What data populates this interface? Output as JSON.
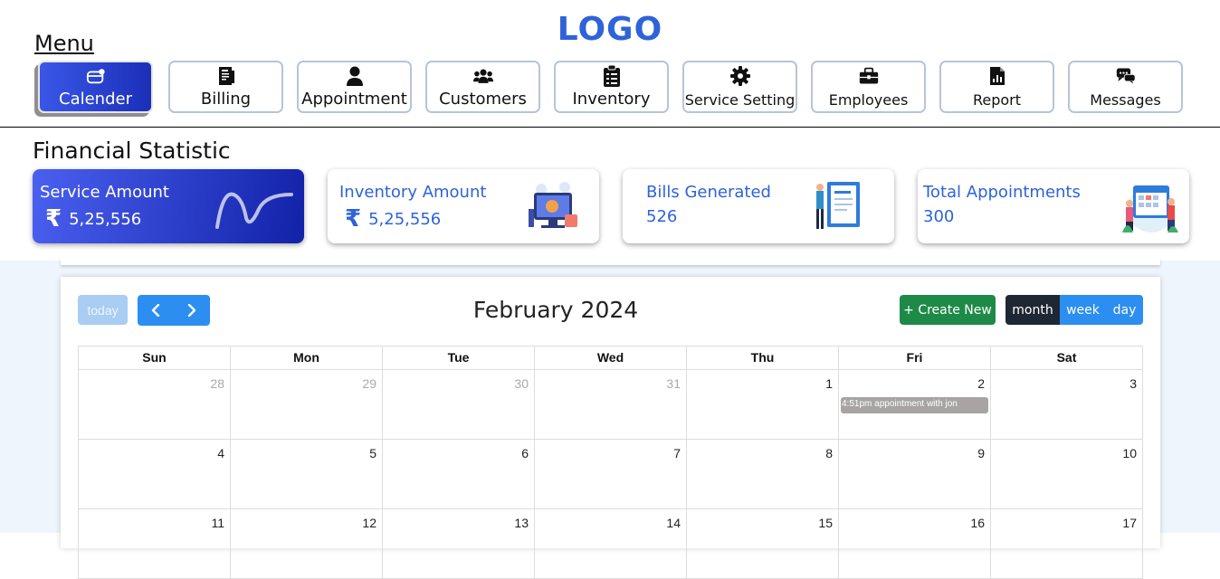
{
  "header": {
    "logo": "LOGO",
    "menu_title": "Menu"
  },
  "nav": [
    {
      "label": "Calender",
      "icon": "calendar-icon",
      "active": true
    },
    {
      "label": "Billing",
      "icon": "bill-icon"
    },
    {
      "label": "Appointment",
      "icon": "user-icon"
    },
    {
      "label": "Customers",
      "icon": "users-icon"
    },
    {
      "label": "Inventory",
      "icon": "clipboard-icon"
    },
    {
      "label": "Service Setting",
      "icon": "gear-icon"
    },
    {
      "label": "Employees",
      "icon": "briefcase-icon"
    },
    {
      "label": "Report",
      "icon": "report-icon"
    },
    {
      "label": "Messages",
      "icon": "messages-icon"
    }
  ],
  "financial": {
    "title": "Financial Statistic",
    "cards": [
      {
        "title": "Service Amount",
        "currency": "₹",
        "value": "5,25,556"
      },
      {
        "title": "Inventory Amount",
        "currency": "₹",
        "value": "5,25,556"
      },
      {
        "title": "Bills Generated",
        "value": "526"
      },
      {
        "title": "Total Appointments",
        "value": "300"
      }
    ]
  },
  "calendar": {
    "today_label": "today",
    "prev_icon": "‹",
    "next_icon": "›",
    "title": "February 2024",
    "create_label": "+ Create New",
    "views": {
      "month": "month",
      "week": "week",
      "day": "day"
    },
    "weekdays": [
      "Sun",
      "Mon",
      "Tue",
      "Wed",
      "Thu",
      "Fri",
      "Sat"
    ],
    "weeks": [
      [
        {
          "d": "28",
          "other": true
        },
        {
          "d": "29",
          "other": true
        },
        {
          "d": "30",
          "other": true
        },
        {
          "d": "31",
          "other": true
        },
        {
          "d": "1"
        },
        {
          "d": "2",
          "event": "4:51pm appointment with jon"
        },
        {
          "d": "3"
        }
      ],
      [
        {
          "d": "4"
        },
        {
          "d": "5"
        },
        {
          "d": "6"
        },
        {
          "d": "7"
        },
        {
          "d": "8"
        },
        {
          "d": "9"
        },
        {
          "d": "10"
        }
      ],
      [
        {
          "d": "11"
        },
        {
          "d": "12"
        },
        {
          "d": "13"
        },
        {
          "d": "14"
        },
        {
          "d": "15"
        },
        {
          "d": "16"
        },
        {
          "d": "17"
        }
      ]
    ]
  },
  "colors": {
    "brand_blue": "#2e63d9",
    "primary_button": "#2b8ef0",
    "create_button": "#1e8a48",
    "active_view": "#1e2734",
    "event_bg": "#a8a4a4"
  }
}
